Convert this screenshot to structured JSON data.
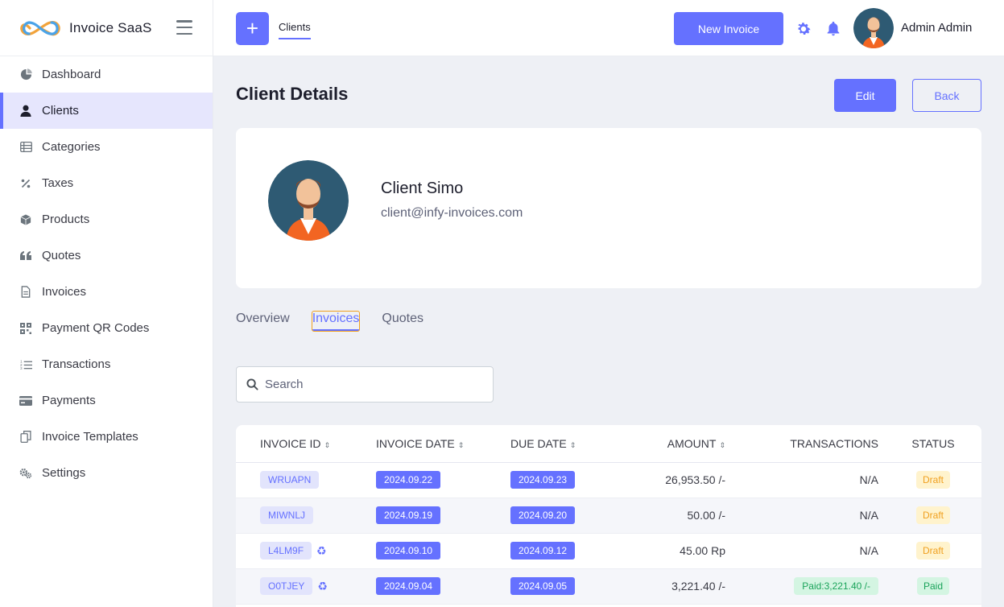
{
  "app": {
    "name": "Invoice SaaS"
  },
  "sidebar": {
    "items": [
      {
        "label": "Dashboard",
        "icon": "pie-chart-icon"
      },
      {
        "label": "Clients",
        "icon": "user-icon",
        "active": true
      },
      {
        "label": "Categories",
        "icon": "list-icon"
      },
      {
        "label": "Taxes",
        "icon": "percent-icon"
      },
      {
        "label": "Products",
        "icon": "box-icon"
      },
      {
        "label": "Quotes",
        "icon": "quote-icon"
      },
      {
        "label": "Invoices",
        "icon": "file-icon"
      },
      {
        "label": "Payment QR Codes",
        "icon": "qr-code-icon"
      },
      {
        "label": "Transactions",
        "icon": "list-ordered-icon"
      },
      {
        "label": "Payments",
        "icon": "credit-card-icon"
      },
      {
        "label": "Invoice Templates",
        "icon": "copy-icon"
      },
      {
        "label": "Settings",
        "icon": "gears-icon"
      }
    ]
  },
  "header": {
    "plus_label": "+",
    "tab": "Clients",
    "new_invoice": "New Invoice",
    "user_name": "Admin Admin"
  },
  "page": {
    "title": "Client Details",
    "edit": "Edit",
    "back": "Back"
  },
  "client": {
    "name": "Client Simo",
    "email": "client@infy-invoices.com"
  },
  "tabs": [
    "Overview",
    "Invoices",
    "Quotes"
  ],
  "active_tab": "Invoices",
  "search": {
    "placeholder": "Search",
    "value": ""
  },
  "table": {
    "columns": [
      "Invoice ID",
      "Invoice Date",
      "Due Date",
      "Amount",
      "Transactions",
      "Status"
    ],
    "rows": [
      {
        "id": "WRUAPN",
        "recurring": false,
        "invoice_date": "2024.09.22",
        "due_date": "2024.09.23",
        "amount": "26,953.50 /-",
        "transactions": "N/A",
        "status": "Draft"
      },
      {
        "id": "MIWNLJ",
        "recurring": false,
        "invoice_date": "2024.09.19",
        "due_date": "2024.09.20",
        "amount": "50.00 /-",
        "transactions": "N/A",
        "status": "Draft"
      },
      {
        "id": "L4LM9F",
        "recurring": true,
        "invoice_date": "2024.09.10",
        "due_date": "2024.09.12",
        "amount": "45.00 Rp",
        "transactions": "N/A",
        "status": "Draft"
      },
      {
        "id": "O0TJEY",
        "recurring": true,
        "invoice_date": "2024.09.04",
        "due_date": "2024.09.05",
        "amount": "3,221.40 /-",
        "transactions": "Paid:3,221.40 /-",
        "status": "Paid"
      }
    ]
  },
  "colors": {
    "accent": "#6571ff",
    "draft_bg": "#fff3cd",
    "draft_text": "#f0a020",
    "paid_bg": "#d4f5e2",
    "paid_text": "#1aa35a"
  }
}
